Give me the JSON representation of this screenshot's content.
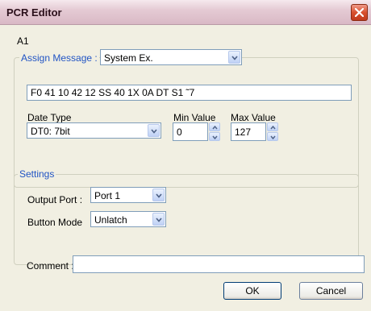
{
  "window": {
    "title": "PCR Editor"
  },
  "header": {
    "id_label": "A1"
  },
  "assign_message": {
    "group_label": "Assign Message :",
    "type_value": "System Ex.",
    "sysex_value": "F0 41 10 42 12 SS 40 1X 0A DT S1 ˜7",
    "date_type_label": "Date Type",
    "date_type_value": "DT0: 7bit",
    "min_label": "Min Value",
    "min_value": "0",
    "max_label": "Max Value",
    "max_value": "127"
  },
  "settings": {
    "group_label": "Settings",
    "output_port_label": "Output Port :",
    "output_port_value": "Port 1",
    "button_mode_label": "Button Mode",
    "button_mode_value": "Unlatch"
  },
  "comment": {
    "label": "Comment :",
    "value": ""
  },
  "buttons": {
    "ok": "OK",
    "cancel": "Cancel"
  },
  "colors": {
    "title_bar": "#e5cbd4",
    "group_label": "#2154c4",
    "close_button": "#d8502e",
    "button_border": "#003c74"
  }
}
